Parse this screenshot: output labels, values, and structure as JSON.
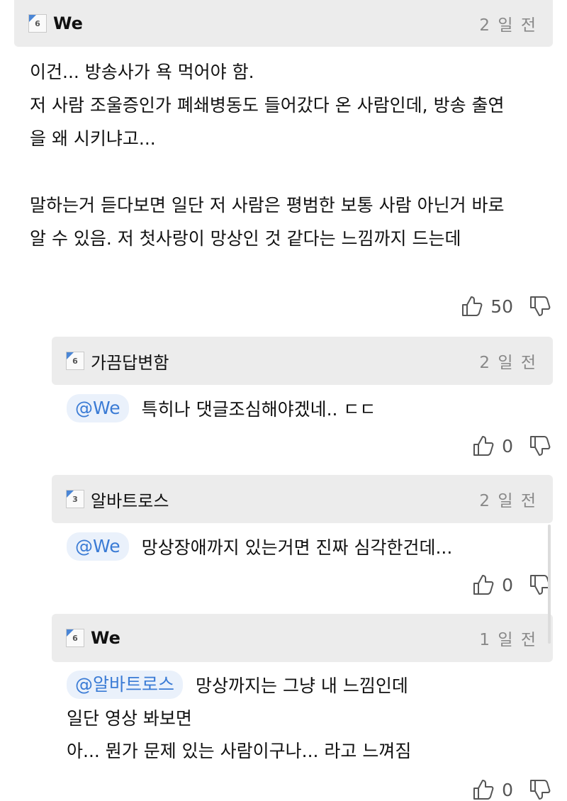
{
  "main": {
    "username": "We",
    "badge": "6",
    "time": "2 일 전",
    "lines": [
      "이건... 방송사가 욕 먹어야 함.",
      "저 사람 조울증인가 폐쇄병동도 들어갔다 온 사람인데, 방송 출연",
      "을 왜 시키냐고...",
      "",
      "말하는거 듣다보면 일단 저 사람은 평범한 보통 사람 아닌거 바로",
      "알 수 있음. 저 첫사랑이 망상인 것 같다는 느낌까지 드는데"
    ],
    "likes": "50"
  },
  "replies": [
    {
      "username": "가끔답변함",
      "badge": "6",
      "time": "2 일 전",
      "mention": "@We",
      "lines": [
        "특히나 댓글조심해야겠네.. ㄷㄷ"
      ],
      "likes": "0"
    },
    {
      "username": "알바트로스",
      "badge": "3",
      "time": "2 일 전",
      "mention": "@We",
      "lines": [
        "망상장애까지 있는거면 진짜 심각한건데..."
      ],
      "likes": "0"
    },
    {
      "username": "We",
      "badge": "6",
      "time": "1 일 전",
      "mention": "@알바트로스",
      "lines": [
        "망상까지는 그냥 내 느낌인데",
        "일단 영상 봐보면",
        "아... 뭔가 문제 있는 사람이구나... 라고 느껴짐"
      ],
      "likes": "0"
    }
  ],
  "icons": {
    "like": "thumbs-up-icon",
    "dislike": "thumbs-down-icon"
  },
  "colors": {
    "header_bg": "#ececec",
    "mention_text": "#3a7bd5",
    "mention_bg": "#eaf1fb",
    "badge_accent": "#4a86d6"
  }
}
